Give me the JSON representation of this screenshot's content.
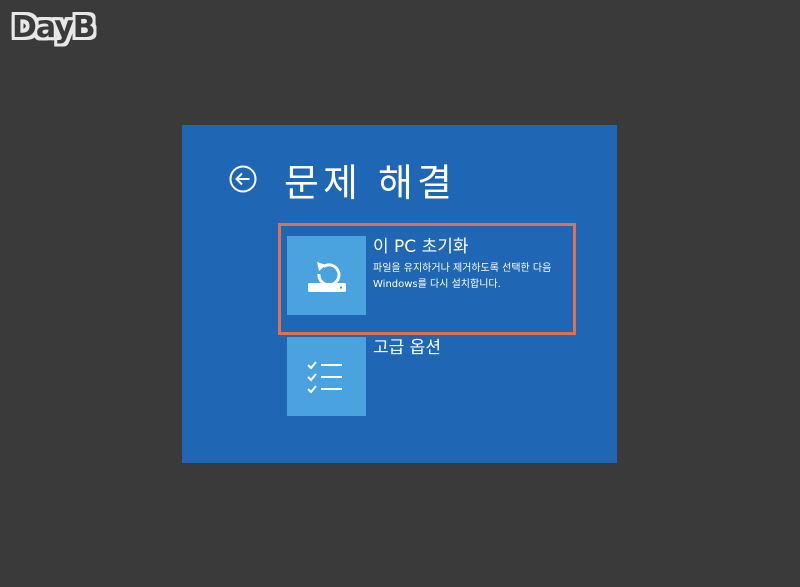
{
  "watermark": {
    "logo_text": "DayB"
  },
  "panel": {
    "title": "문제 해결",
    "back_icon": "back-arrow-circle-icon",
    "options": [
      {
        "title": "이 PC 초기화",
        "description": "파일을 유지하거나 제거하도록 선택한 다음 Windows를 다시 설치합니다.",
        "icon": "reset-pc-icon",
        "highlighted": true
      },
      {
        "title": "고급 옵션",
        "description": "",
        "icon": "checklist-icon",
        "highlighted": false
      }
    ]
  },
  "colors": {
    "background": "#3a3a3a",
    "panel": "#1f66b4",
    "tile": "#4aa3de",
    "highlight": "#e07050",
    "text": "#ffffff"
  }
}
